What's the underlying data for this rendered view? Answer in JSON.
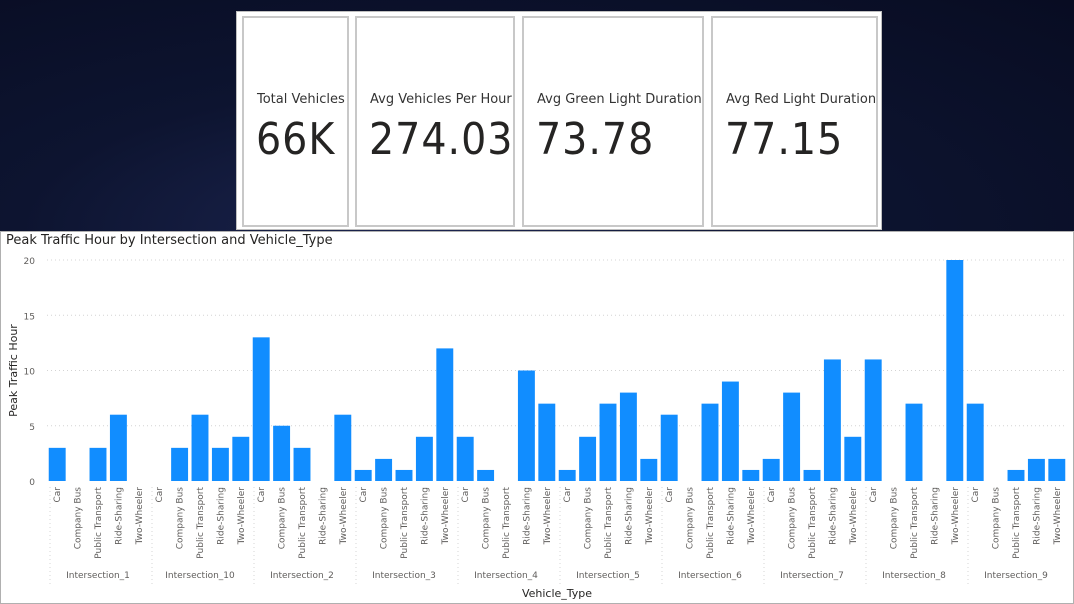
{
  "cards": [
    {
      "label": "Total Vehicles",
      "value": "66K"
    },
    {
      "label": "Avg Vehicles Per Hour",
      "value": "274.03"
    },
    {
      "label": "Avg Green Light Duration",
      "value": "73.78"
    },
    {
      "label": "Avg Red Light Duration",
      "value": "77.15"
    }
  ],
  "chart_data": {
    "type": "bar",
    "title": "Peak Traffic Hour by Intersection and Vehicle_Type",
    "xlabel": "Vehicle_Type",
    "ylabel": "Peak Traffic Hour",
    "ylim": [
      0,
      20
    ],
    "yticks": [
      0,
      5,
      10,
      15,
      20
    ],
    "grid": true,
    "bar_color": "#118DFF",
    "groups": [
      {
        "name": "Intersection_1",
        "categories": [
          "Car",
          "Company Bus",
          "Public Transport",
          "Ride-Sharing",
          "Two-Wheeler"
        ],
        "values": [
          3,
          0,
          3,
          6,
          0
        ]
      },
      {
        "name": "Intersection_10",
        "categories": [
          "Car",
          "Company Bus",
          "Public Transport",
          "Ride-Sharing",
          "Two-Wheeler"
        ],
        "values": [
          0,
          3,
          6,
          3,
          4
        ]
      },
      {
        "name": "Intersection_2",
        "categories": [
          "Car",
          "Company Bus",
          "Public Transport",
          "Ride-Sharing",
          "Two-Wheeler"
        ],
        "values": [
          13,
          5,
          3,
          0,
          6
        ]
      },
      {
        "name": "Intersection_3",
        "categories": [
          "Car",
          "Company Bus",
          "Public Transport",
          "Ride-Sharing",
          "Two-Wheeler"
        ],
        "values": [
          1,
          2,
          1,
          4,
          12
        ]
      },
      {
        "name": "Intersection_4",
        "categories": [
          "Car",
          "Company Bus",
          "Public Transport",
          "Ride-Sharing",
          "Two-Wheeler"
        ],
        "values": [
          4,
          1,
          0,
          10,
          7
        ]
      },
      {
        "name": "Intersection_5",
        "categories": [
          "Car",
          "Company Bus",
          "Public Transport",
          "Ride-Sharing",
          "Two-Wheeler"
        ],
        "values": [
          1,
          4,
          7,
          8,
          2
        ]
      },
      {
        "name": "Intersection_6",
        "categories": [
          "Car",
          "Company Bus",
          "Public Transport",
          "Ride-Sharing",
          "Two-Wheeler"
        ],
        "values": [
          6,
          0,
          7,
          9,
          1
        ]
      },
      {
        "name": "Intersection_7",
        "categories": [
          "Car",
          "Company Bus",
          "Public Transport",
          "Ride-Sharing",
          "Two-Wheeler"
        ],
        "values": [
          2,
          8,
          1,
          11,
          4
        ]
      },
      {
        "name": "Intersection_8",
        "categories": [
          "Car",
          "Company Bus",
          "Public Transport",
          "Ride-Sharing",
          "Two-Wheeler"
        ],
        "values": [
          11,
          0,
          7,
          0,
          20
        ]
      },
      {
        "name": "Intersection_9",
        "categories": [
          "Car",
          "Company Bus",
          "Public Transport",
          "Ride-Sharing",
          "Two-Wheeler"
        ],
        "values": [
          7,
          0,
          1,
          2,
          2
        ]
      }
    ]
  }
}
